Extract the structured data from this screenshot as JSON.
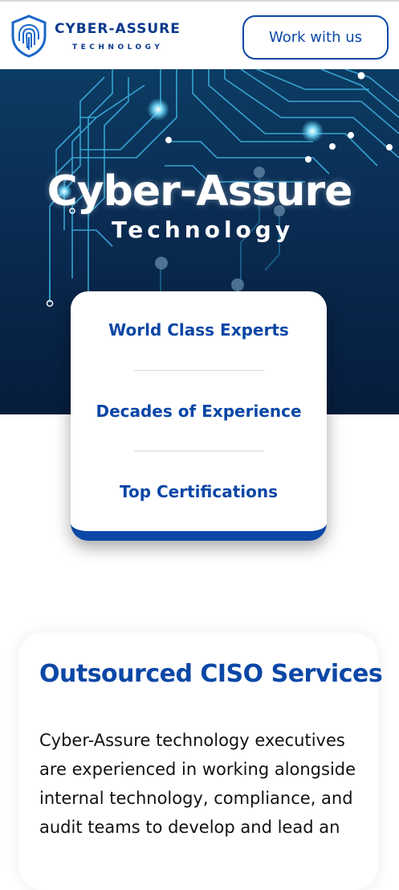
{
  "header": {
    "brand_name": "CYBER-ASSURE",
    "brand_sub": "TECHNOLOGY",
    "cta_label": "Work with us",
    "logo_icon": "fingerprint-shield-icon"
  },
  "hero": {
    "title": "Cyber-Assure",
    "subtitle": "Technology",
    "background": "circuit-board"
  },
  "features": {
    "items": [
      {
        "label": "World Class Experts"
      },
      {
        "label": "Decades of Experience"
      },
      {
        "label": "Top Certifications"
      }
    ]
  },
  "ciso": {
    "title": "Outsourced CISO Services",
    "body": "Cyber-Assure technology executives are experienced in working alongside internal technology, compliance, and audit teams to develop and lead an"
  },
  "colors": {
    "brand_blue": "#0b47a6",
    "hero_dark": "#061d3c",
    "circuit_cyan": "#4fd3ff"
  }
}
